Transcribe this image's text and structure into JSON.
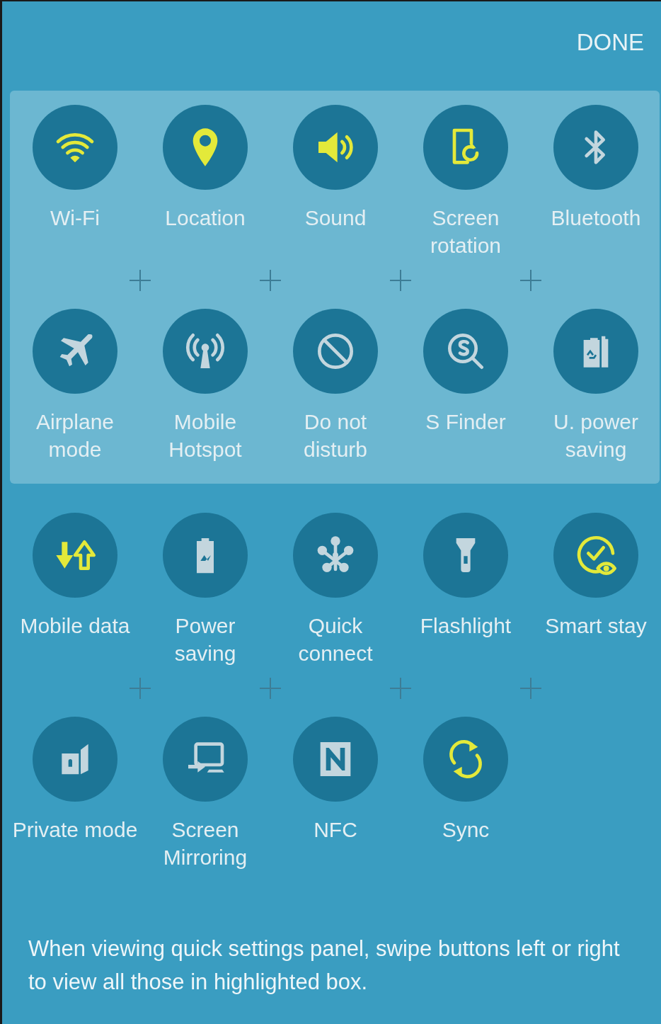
{
  "done_button": "DONE",
  "highlighted_tiles": [
    {
      "label": "Wi-Fi",
      "on": true
    },
    {
      "label": "Location",
      "on": true
    },
    {
      "label": "Sound",
      "on": true
    },
    {
      "label": "Screen rotation",
      "on": true
    },
    {
      "label": "Bluetooth",
      "on": false
    },
    {
      "label": "Airplane mode",
      "on": false
    },
    {
      "label": "Mobile Hotspot",
      "on": false
    },
    {
      "label": "Do not disturb",
      "on": false
    },
    {
      "label": "S Finder",
      "on": false
    },
    {
      "label": "U. power saving",
      "on": false
    }
  ],
  "other_tiles": [
    {
      "label": "Mobile data",
      "on": true
    },
    {
      "label": "Power saving",
      "on": false
    },
    {
      "label": "Quick connect",
      "on": false
    },
    {
      "label": "Flashlight",
      "on": false
    },
    {
      "label": "Smart stay",
      "on": true
    },
    {
      "label": "Private mode",
      "on": false
    },
    {
      "label": "Screen Mirroring",
      "on": false
    },
    {
      "label": "NFC",
      "on": false
    },
    {
      "label": "Sync",
      "on": true
    }
  ],
  "hint": "When viewing quick settings panel, swipe buttons left or right to view all those in highlighted box."
}
